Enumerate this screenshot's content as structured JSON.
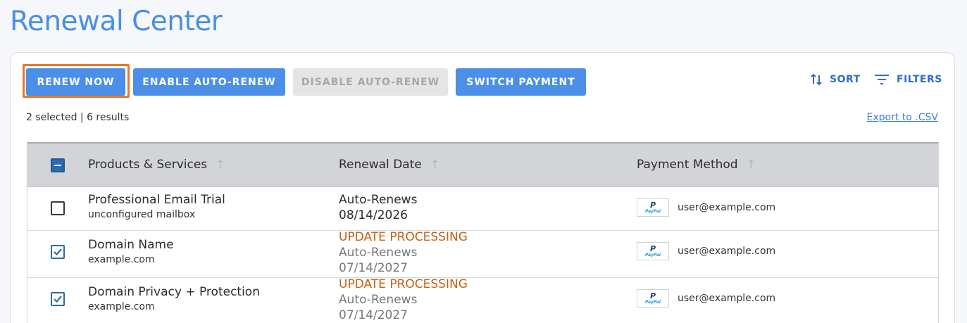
{
  "page": {
    "title": "Renewal Center"
  },
  "toolbar": {
    "renew_now": "RENEW NOW",
    "enable_auto_renew": "ENABLE AUTO-RENEW",
    "disable_auto_renew": "DISABLE AUTO-RENEW",
    "switch_payment": "SWITCH PAYMENT",
    "sort": "SORT",
    "filters": "FILTERS"
  },
  "summary": {
    "results": "2 selected | 6 results",
    "export": "Export to .CSV"
  },
  "table": {
    "columns": [
      "Products & Services",
      "Renewal Date",
      "Payment Method"
    ],
    "rows": [
      {
        "name": "Professional Email Trial",
        "sub": "unconfigured mailbox",
        "status": "",
        "renewal": "Auto-Renews",
        "date": "08/14/2026",
        "payment": "user@example.com",
        "checked": false
      },
      {
        "name": "Domain Name",
        "sub": "example.com",
        "status": "UPDATE PROCESSING",
        "renewal": "Auto-Renews",
        "date": "07/14/2027",
        "payment": "user@example.com",
        "checked": true
      },
      {
        "name": "Domain Privacy + Protection",
        "sub": "example.com",
        "status": "UPDATE PROCESSING",
        "renewal": "Auto-Renews",
        "date": "07/14/2027",
        "payment": "user@example.com",
        "checked": true
      }
    ]
  },
  "payment_logo": {
    "brand": "PayPal",
    "icon": "paypal-logo"
  },
  "colors": {
    "primary": "#4b8fe8",
    "title": "#4a8fe0",
    "focus": "#f07624",
    "alert": "#c26012",
    "link": "#2f6fc4"
  }
}
